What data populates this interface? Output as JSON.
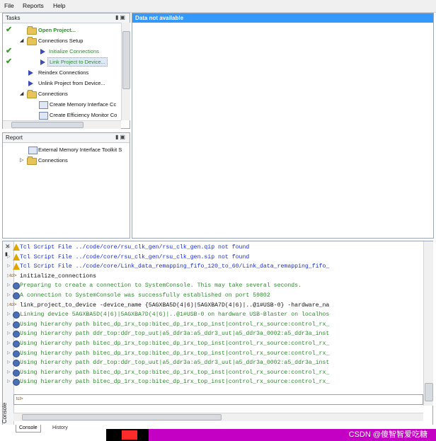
{
  "menu": [
    "File",
    "Reports",
    "Help"
  ],
  "tasks_pane": {
    "title": "Tasks",
    "items": [
      {
        "label": "Open Project...",
        "checked": true,
        "icon": "folder-icon",
        "style": "link-bold"
      },
      {
        "label": "Connections Setup",
        "checked": false,
        "icon": "folder-icon",
        "style": "normal"
      },
      {
        "label": "Initialize Connections",
        "checked": true,
        "icon": "run-icon",
        "style": "link"
      },
      {
        "label": "Link Project to Device...",
        "checked": true,
        "icon": "run-icon",
        "style": "link-selected"
      },
      {
        "label": "Reindex Connections",
        "checked": false,
        "icon": "run-icon",
        "style": "normal"
      },
      {
        "label": "Unlink Project from Device...",
        "checked": false,
        "icon": "run-icon",
        "style": "normal"
      },
      {
        "label": "Connections",
        "checked": false,
        "icon": "folder-icon",
        "style": "normal"
      },
      {
        "label": "Create Memory Interface Cc",
        "checked": false,
        "icon": "report-icon",
        "style": "normal"
      },
      {
        "label": "Create Efficiency Monitor Co",
        "checked": false,
        "icon": "report-icon",
        "style": "normal"
      }
    ]
  },
  "report_pane": {
    "title": "Report",
    "items": [
      {
        "label": "External Memory Interface Toolkit S",
        "icon": "report-icon"
      },
      {
        "label": "Connections",
        "icon": "folder-icon"
      }
    ]
  },
  "main_panel": {
    "header": "Data not available"
  },
  "console": {
    "lines": [
      {
        "kind": "warning",
        "text": "Tcl Script File ../code/core/rsu_clk_gen/rsu_clk_gen.qip not found"
      },
      {
        "kind": "warning",
        "text": "Tcl Script File ../code/core/rsu_clk_gen/rsu_clk_gen.sip not found"
      },
      {
        "kind": "warning",
        "text": "Tcl Script File ../code/core/Link_data_remapping_fifo_120_to_60/Link_data_remapping_fifo_"
      },
      {
        "kind": "command",
        "text": "initialize_connections"
      },
      {
        "kind": "info",
        "text": "Preparing to create a connection to SystemConsole. This may take several seconds."
      },
      {
        "kind": "info",
        "text": "A connection to SystemConsole was successfully established on port 59802"
      },
      {
        "kind": "command",
        "text": "link_project_to_device -device_name {5AGXBA5D(4|6)|5AGXBA7D(4|6)|..@1#USB-0} -hardware_na"
      },
      {
        "kind": "info",
        "text": "Linking device 5AGXBA5D(4|6)|5AGXBA7D(4|6)|..@1#USB-0 on hardware USB-Blaster on localhos"
      },
      {
        "kind": "info",
        "text": "Using hierarchy path bitec_dp_1rx_top:bitec_dp_1rx_top_inst|control_rx_source:control_rx_"
      },
      {
        "kind": "info",
        "text": "Using hierarchy path ddr_top:ddr_top_uut|a5_ddr3a:a5_ddr3_uut|a5_ddr3a_0002:a5_ddr3a_inst"
      },
      {
        "kind": "info",
        "text": "Using hierarchy path bitec_dp_1rx_top:bitec_dp_1rx_top_inst|control_rx_source:control_rx_"
      },
      {
        "kind": "info",
        "text": "Using hierarchy path bitec_dp_1rx_top:bitec_dp_1rx_top_inst|control_rx_source:control_rx_"
      },
      {
        "kind": "info",
        "text": "Using hierarchy path ddr_top:ddr_top_uut|a5_ddr3a:a5_ddr3_uut|a5_ddr3a_0002:a5_ddr3a_inst"
      },
      {
        "kind": "info",
        "text": "Using hierarchy path bitec_dp_1rx_top:bitec_dp_1rx_top_inst|control_rx_source:control_rx_"
      },
      {
        "kind": "info",
        "text": "Using hierarchy path bitec_dp_1rx_top:bitec_dp_1rx_top_inst|control_rx_source:control_rx_"
      }
    ],
    "input_prompt": "tcl>",
    "side_label": "Console",
    "tabs": [
      "Console",
      "History"
    ]
  },
  "watermark": "CSDN @傻智智爱吃糖",
  "colors": {
    "selection": "#3399ff",
    "warning_text": "#1a2fcf",
    "info_text": "#2e8b2e",
    "command_text": "#111111",
    "link_text": "#2e8b2e",
    "watermark_bar": "#c400c4"
  }
}
